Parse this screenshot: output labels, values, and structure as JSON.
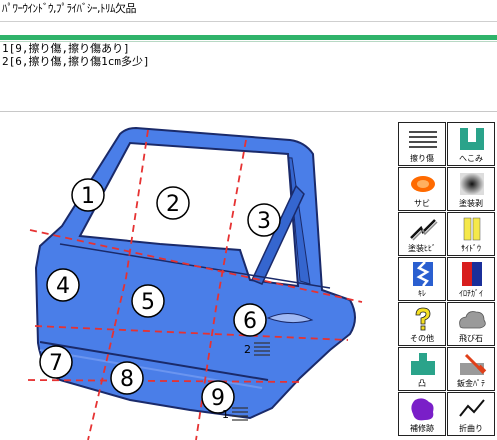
{
  "header": {
    "title": "ﾊﾟﾜｰｳｲﾝﾄﾞｳ,ﾌﾟﾗｲﾊﾞｼｰ,ﾄﾘﾑ欠品"
  },
  "notes": [
    "1[9,擦り傷,擦り傷あり]",
    "2[6,擦り傷,擦り傷1cm多少]"
  ],
  "diagram": {
    "regions": [
      "1",
      "2",
      "3",
      "4",
      "5",
      "6",
      "7",
      "8",
      "9"
    ],
    "markers": [
      "2",
      "1"
    ]
  },
  "colors": {
    "door": "#4a7ee8",
    "window": "#ffffff",
    "grid": "#e63232",
    "accent": "#2fb36a",
    "dent": "#2aa38a"
  },
  "palette": [
    {
      "label": "擦り傷",
      "icon": "scratch-lines-icon"
    },
    {
      "label": "へこみ",
      "icon": "dent-icon"
    },
    {
      "label": "サビ",
      "icon": "rust-icon"
    },
    {
      "label": "塗装剥",
      "icon": "paint-peel-icon"
    },
    {
      "label": "塗装ﾋﾋﾞ",
      "icon": "paint-crack-icon"
    },
    {
      "label": "ｻｲﾄﾞｳ",
      "icon": "side-icon"
    },
    {
      "label": "ｷﾚ",
      "icon": "tear-icon"
    },
    {
      "label": "ｲﾛﾁｶﾞｲ",
      "icon": "color-diff-icon"
    },
    {
      "label": "その他",
      "icon": "question-icon"
    },
    {
      "label": "飛び石",
      "icon": "stone-chip-icon"
    },
    {
      "label": "凸",
      "icon": "bump-icon"
    },
    {
      "label": "鈑金ﾊﾟﾃ",
      "icon": "putty-icon"
    },
    {
      "label": "補修跡",
      "icon": "repair-mark-icon"
    },
    {
      "label": "折曲り",
      "icon": "bend-icon"
    }
  ]
}
